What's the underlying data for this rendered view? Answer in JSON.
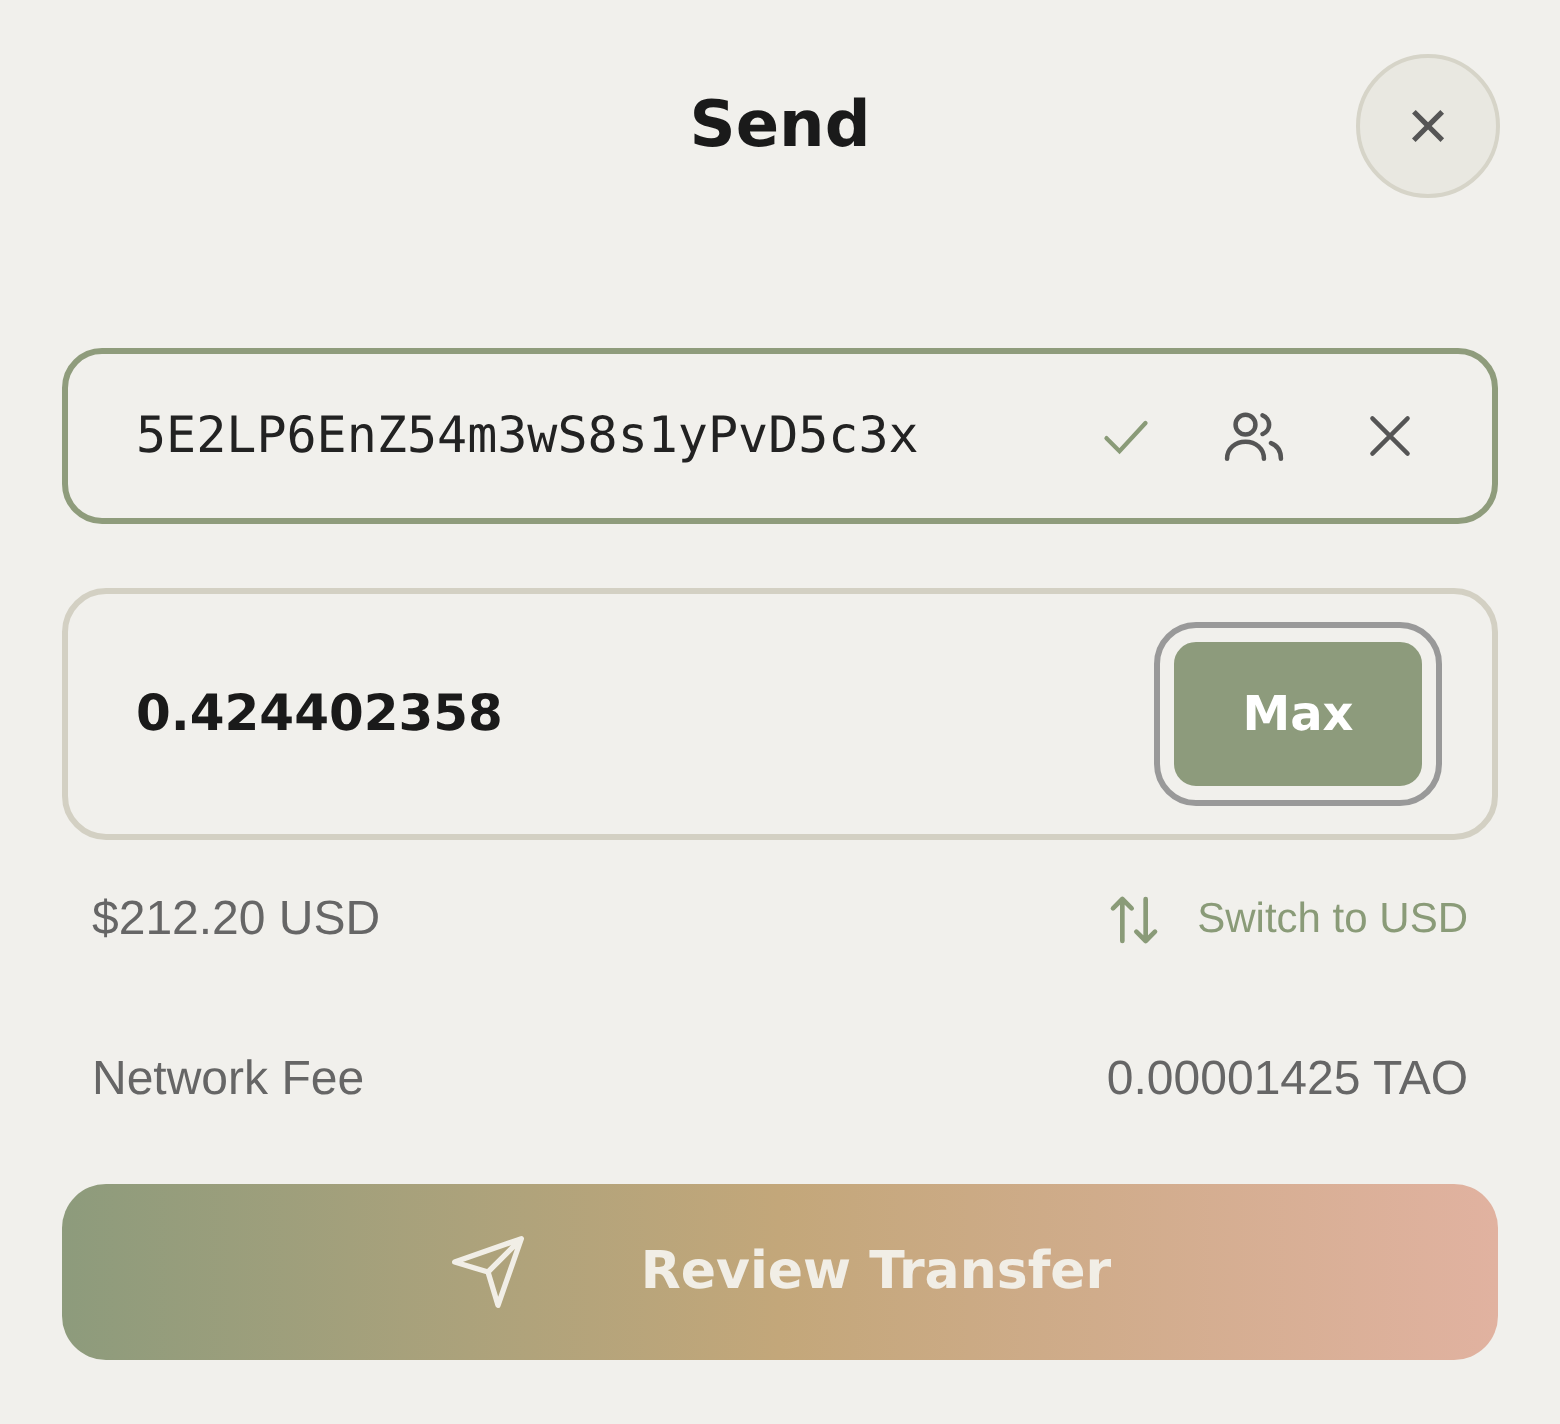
{
  "header": {
    "title": "Send",
    "close": "×"
  },
  "recipient": {
    "value": "5E2LP6EnZ54m3wS8s1yPvD5c3x",
    "valid": true
  },
  "amount": {
    "value": "0.424402358",
    "max_label": "Max"
  },
  "conversion": {
    "usd": "$212.20 USD",
    "switch_label": "Switch to USD"
  },
  "fee": {
    "label": "Network Fee",
    "value": "0.00001425 TAO"
  },
  "submit": {
    "label": "Review Transfer"
  }
}
